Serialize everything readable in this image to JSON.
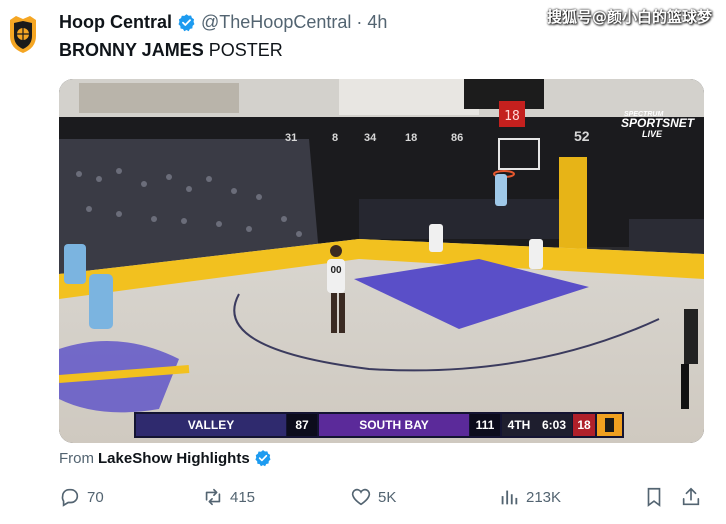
{
  "watermark": "搜狐号@颜小白的篮球梦",
  "tweet": {
    "author_name": "Hoop Central",
    "handle": "@TheHoopCentral",
    "separator": "·",
    "time": "4h",
    "text_bold": "BRONNY JAMES",
    "text_rest": " POSTER"
  },
  "media": {
    "broadcaster_line1": "SPECTRUM",
    "broadcaster_line2": "SPORTSNET",
    "broadcaster_line3": "LIVE",
    "shot_clock": "18",
    "scoreboard_numbers": [
      "31",
      "8",
      "34",
      "18",
      "86",
      "52"
    ],
    "player_number": "00",
    "scorebug": {
      "team_away": "VALLEY",
      "score_away": "87",
      "team_home": "SOUTH BAY",
      "score_home": "111",
      "period": "4TH",
      "clock": "6:03",
      "shot_clock": "18"
    }
  },
  "source": {
    "from_label": "From",
    "name": "LakeShow Highlights"
  },
  "actions": {
    "replies": "70",
    "reposts": "415",
    "likes": "5K",
    "views": "213K"
  },
  "colors": {
    "verified_blue": "#1d9bf0",
    "court_purple": "#5a4fc8",
    "court_gold": "#f2c11f"
  }
}
